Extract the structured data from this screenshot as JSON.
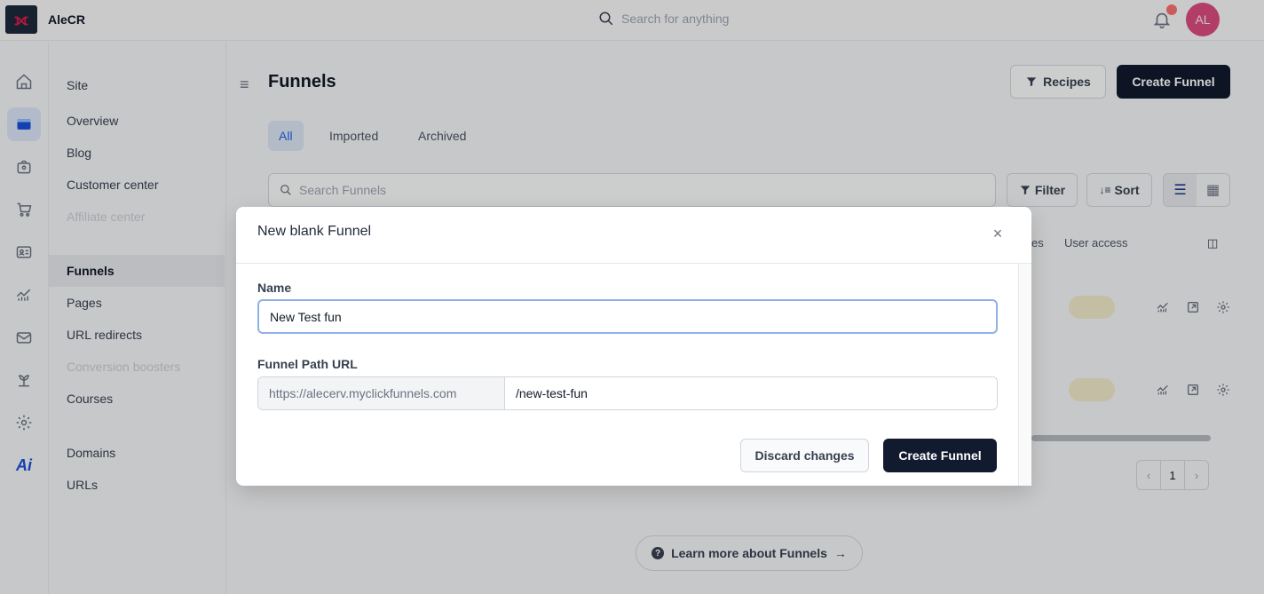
{
  "app": {
    "name": "AleCR",
    "avatar_initials": "AL"
  },
  "header": {
    "search_placeholder": "Search for anything"
  },
  "subnav": {
    "items": [
      {
        "label": "Site",
        "disabled": false
      },
      {
        "label": "Overview",
        "disabled": false
      },
      {
        "label": "Blog",
        "disabled": false
      },
      {
        "label": "Customer center",
        "disabled": false
      },
      {
        "label": "Affiliate center",
        "disabled": true
      },
      {
        "label": "Funnels",
        "disabled": false,
        "active": true
      },
      {
        "label": "Pages",
        "disabled": false
      },
      {
        "label": "URL redirects",
        "disabled": false
      },
      {
        "label": "Conversion boosters",
        "disabled": true
      },
      {
        "label": "Courses",
        "disabled": false
      },
      {
        "label": "Domains",
        "disabled": false
      },
      {
        "label": "URLs",
        "disabled": false
      }
    ]
  },
  "main": {
    "title": "Funnels",
    "recipes_label": "Recipes",
    "create_label": "Create Funnel",
    "tabs": [
      "All",
      "Imported",
      "Archived"
    ],
    "search_placeholder": "Search Funnels",
    "filter_label": "Filter",
    "sort_label": "Sort",
    "columns": [
      "es",
      "User access"
    ],
    "page_number": "1",
    "learn_more": "Learn more about Funnels"
  },
  "modal": {
    "title": "New blank Funnel",
    "name_label": "Name",
    "name_value": "New Test fun",
    "path_label": "Funnel Path URL",
    "url_prefix": "https://alecerv.myclickfunnels.com",
    "path_value": "/new-test-fun",
    "discard_label": "Discard changes",
    "create_label": "Create Funnel"
  },
  "colors": {
    "accent": "#111a2e",
    "active_tab": "#2563eb",
    "avatar": "#d94c7f"
  }
}
